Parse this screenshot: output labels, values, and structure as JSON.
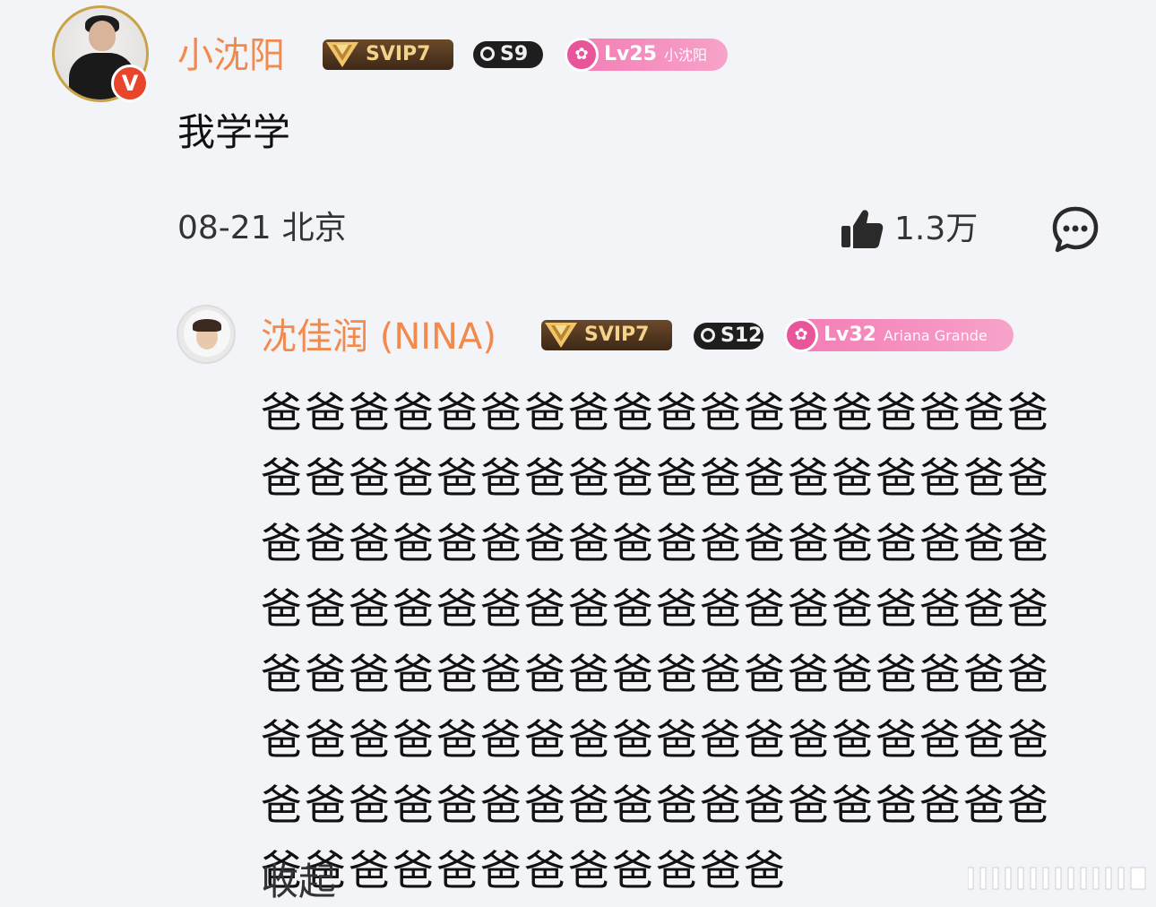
{
  "comment": {
    "author": {
      "name": "小沈阳",
      "verified_badge": "V",
      "svip": "SVIP7",
      "season_badge": "S9",
      "fan_level": "Lv25",
      "fan_name": "小沈阳"
    },
    "text": "我学学",
    "date": "08-21",
    "location": "北京",
    "like_count": "1.3万",
    "icons": {
      "like": "thumbs-up-icon",
      "reply": "comment-bubble-icon"
    }
  },
  "reply": {
    "author": {
      "name": "沈佳润 (NINA)",
      "svip": "SVIP7",
      "season_badge": "S12",
      "fan_level": "Lv32",
      "fan_name": "Ariana Grande"
    },
    "text": "爸爸爸爸爸爸爸爸爸爸爸爸爸爸爸爸爸爸爸爸爸爸爸爸爸爸爸爸爸爸爸爸爸爸爸爸爸爸爸爸爸爸爸爸爸爸爸爸爸爸爸爸爸爸爸爸爸爸爸爸爸爸爸爸爸爸爸爸爸爸爸爸爸爸爸爸爸爸爸爸爸爸爸爸爸爸爸爸爸爸爸爸爸爸爸爸爸爸爸爸爸爸爸爸爸爸爸爸爸爸爸爸爸爸爸爸爸爸爸爸爸爸爸爸爸爸爸爸爸爸爸爸爸爸爸爸爸爸",
    "collapse_label": "收起"
  },
  "colors": {
    "background": "#f3f4f8",
    "username": "#f28a4e",
    "verified": "#e8452b",
    "fan_badge": "#f37bb4",
    "svip_gold": "#f5d28a"
  }
}
